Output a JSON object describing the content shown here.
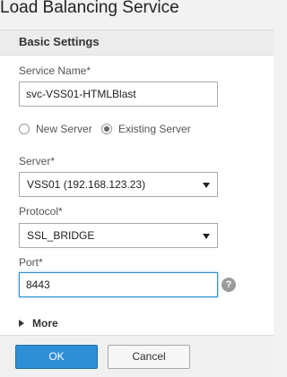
{
  "dialog": {
    "title": "Load Balancing Service"
  },
  "section": {
    "title": "Basic Settings"
  },
  "fields": {
    "service_name": {
      "label": "Service Name*",
      "value": "svc-VSS01-HTMLBlast"
    },
    "server_type": {
      "options": [
        {
          "label": "New Server",
          "checked": false
        },
        {
          "label": "Existing Server",
          "checked": true
        }
      ]
    },
    "server": {
      "label": "Server*",
      "value": "VSS01 (192.168.123.23)"
    },
    "protocol": {
      "label": "Protocol*",
      "value": "SSL_BRIDGE"
    },
    "port": {
      "label": "Port*",
      "value": "8443",
      "help": "?"
    }
  },
  "more": {
    "label": "More"
  },
  "footer": {
    "ok_label": "OK",
    "cancel_label": "Cancel"
  },
  "colors": {
    "primary": "#2e8fd6",
    "focus": "#2d8fd0"
  }
}
